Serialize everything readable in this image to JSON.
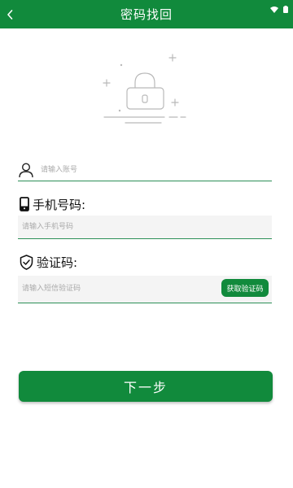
{
  "header": {
    "title": "密码找回",
    "back_icon": "chevron-left-icon",
    "background": "#118a3c"
  },
  "status_bar": {
    "icons": [
      "wifi-icon",
      "battery-icon"
    ]
  },
  "illustration": {
    "icon": "lock-icon"
  },
  "account": {
    "icon": "user-icon",
    "placeholder": "请输入账号",
    "value": ""
  },
  "phone": {
    "icon": "phone-icon",
    "label": "手机号码:",
    "placeholder": "请输入手机号码",
    "value": ""
  },
  "verification": {
    "icon": "shield-check-icon",
    "label": "验证码:",
    "placeholder": "请输入短信验证码",
    "value": "",
    "button_label": "获取验证码"
  },
  "next_button": {
    "label": "下一步"
  },
  "colors": {
    "accent": "#118a3c",
    "divider": "#2c8f57",
    "field_bg": "#f4f4f4"
  }
}
